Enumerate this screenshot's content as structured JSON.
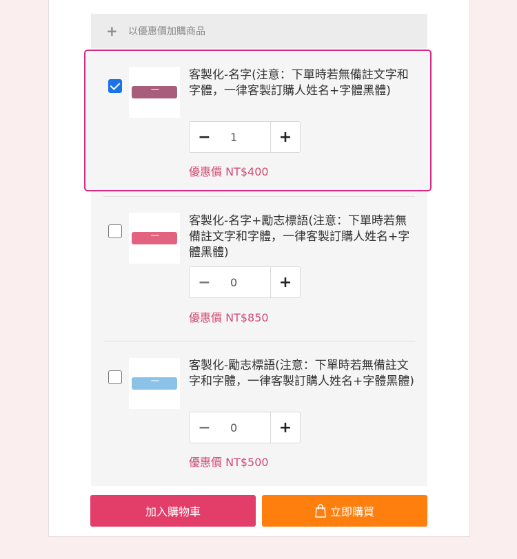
{
  "addon": {
    "title": "以優惠價加購商品"
  },
  "items": [
    {
      "name": "客製化-名字(注意：下單時若無備註文字和字體，一律客製訂購人姓名+字體黑體)",
      "quantity": "1",
      "price": "優惠價 NT$400",
      "checked": true,
      "thumb_color": "#a85d7a"
    },
    {
      "name": "客製化-名字+勵志標語(注意：下單時若無備註文字和字體，一律客製訂購人姓名+字體黑體)",
      "quantity": "0",
      "price": "優惠價 NT$850",
      "checked": false,
      "thumb_color": "#e2627f"
    },
    {
      "name": "客製化-勵志標語(注意：下單時若無備註文字和字體，一律客製訂購人姓名+字體黑體)",
      "quantity": "0",
      "price": "優惠價 NT$500",
      "checked": false,
      "thumb_color": "#8dc2e8"
    }
  ],
  "actions": {
    "add_to_cart": "加入購物車",
    "buy_now": "立即購買"
  },
  "colors": {
    "accent_border": "#d42a86",
    "cart_button": "#e33d6a",
    "buy_button": "#ff7f0e",
    "price": "#d04a72"
  }
}
